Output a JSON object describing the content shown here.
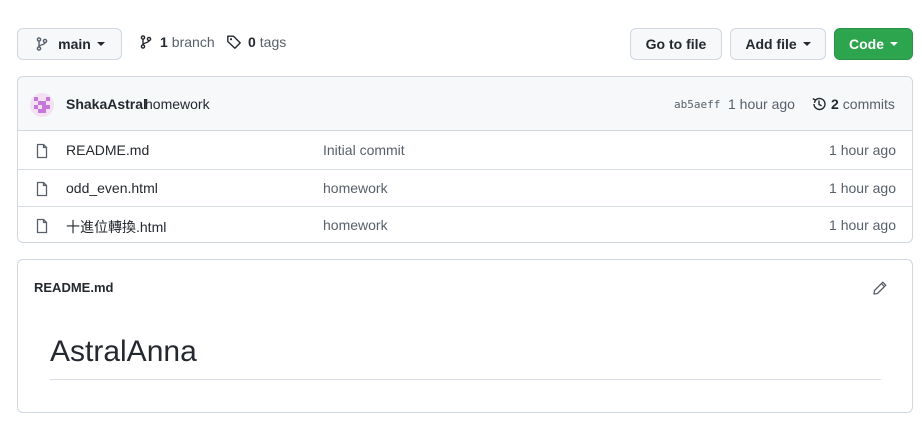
{
  "toolbar": {
    "branch_select": "main",
    "branches_count": "1",
    "branches_label": "branch",
    "tags_count": "0",
    "tags_label": "tags",
    "go_to_file": "Go to file",
    "add_file": "Add file",
    "code": "Code"
  },
  "commit": {
    "author": "ShakaAstral",
    "message": "homework",
    "sha": "ab5aeff",
    "time": "1 hour ago",
    "commits_count": "2",
    "commits_label": "commits"
  },
  "files": [
    {
      "name": "README.md",
      "message": "Initial commit",
      "age": "1 hour ago"
    },
    {
      "name": "odd_even.html",
      "message": "homework",
      "age": "1 hour ago"
    },
    {
      "name": "十進位轉換.html",
      "message": "homework",
      "age": "1 hour ago"
    }
  ],
  "readme": {
    "filename": "README.md",
    "heading": "AstralAnna"
  },
  "colors": {
    "code_button": "#2da44e",
    "border": "#d0d7de",
    "header_bg": "#f6f8fa",
    "muted_text": "#57606a"
  }
}
